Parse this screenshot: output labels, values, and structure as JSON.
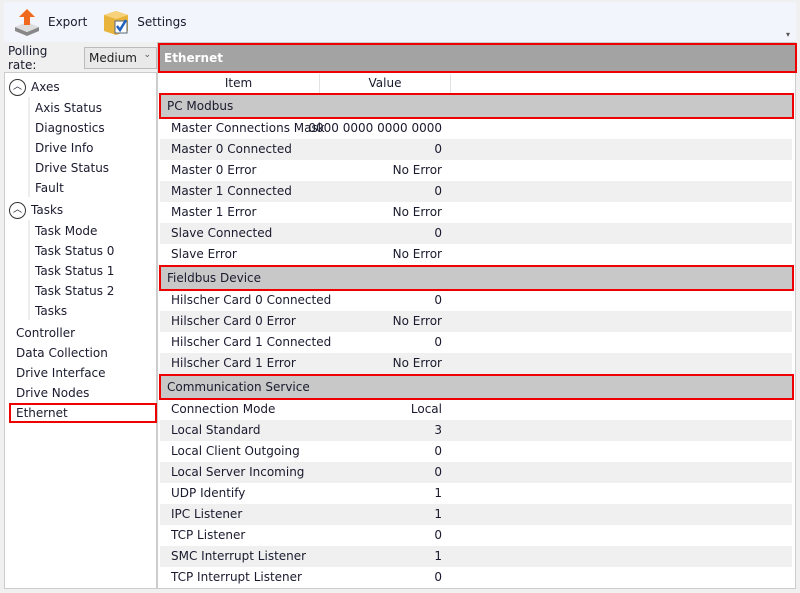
{
  "toolbar": {
    "export_label": "Export",
    "settings_label": "Settings"
  },
  "polling": {
    "label": "Polling rate:",
    "value": "Medium"
  },
  "tree": {
    "groups": [
      {
        "label": "Axes",
        "children": [
          "Axis Status",
          "Diagnostics",
          "Drive Info",
          "Drive Status",
          "Fault"
        ]
      },
      {
        "label": "Tasks",
        "children": [
          "Task Mode",
          "Task Status 0",
          "Task Status 1",
          "Task Status 2",
          "Tasks"
        ]
      }
    ],
    "top_items": [
      "Controller",
      "Data Collection",
      "Drive Interface",
      "Drive Nodes",
      "Ethernet"
    ],
    "selected": "Ethernet"
  },
  "panel": {
    "title": "Ethernet",
    "columns": [
      "Item",
      "Value"
    ],
    "sections": [
      {
        "name": "PC Modbus",
        "rows": [
          [
            "Master Connections Mask",
            "0000 0000 0000 0000"
          ],
          [
            "Master 0 Connected",
            "0"
          ],
          [
            "Master 0 Error",
            "No Error"
          ],
          [
            "Master 1 Connected",
            "0"
          ],
          [
            "Master 1 Error",
            "No Error"
          ],
          [
            "Slave Connected",
            "0"
          ],
          [
            "Slave Error",
            "No Error"
          ]
        ]
      },
      {
        "name": "Fieldbus Device",
        "rows": [
          [
            "Hilscher Card 0 Connected",
            "0"
          ],
          [
            "Hilscher Card 0 Error",
            "No Error"
          ],
          [
            "Hilscher Card 1 Connected",
            "0"
          ],
          [
            "Hilscher Card 1 Error",
            "No Error"
          ]
        ]
      },
      {
        "name": "Communication Service",
        "rows": [
          [
            "Connection Mode",
            "Local"
          ],
          [
            "Local Standard",
            "3"
          ],
          [
            "Local Client Outgoing",
            "0"
          ],
          [
            "Local Server Incoming",
            "0"
          ],
          [
            "UDP Identify",
            "1"
          ],
          [
            "IPC Listener",
            "1"
          ],
          [
            "TCP Listener",
            "0"
          ],
          [
            "SMC Interrupt Listener",
            "1"
          ],
          [
            "TCP Interrupt Listener",
            "0"
          ]
        ]
      }
    ]
  },
  "colors": {
    "highlight": "#e00000",
    "header": "#a3a3a3",
    "section": "#c8c8c8"
  }
}
